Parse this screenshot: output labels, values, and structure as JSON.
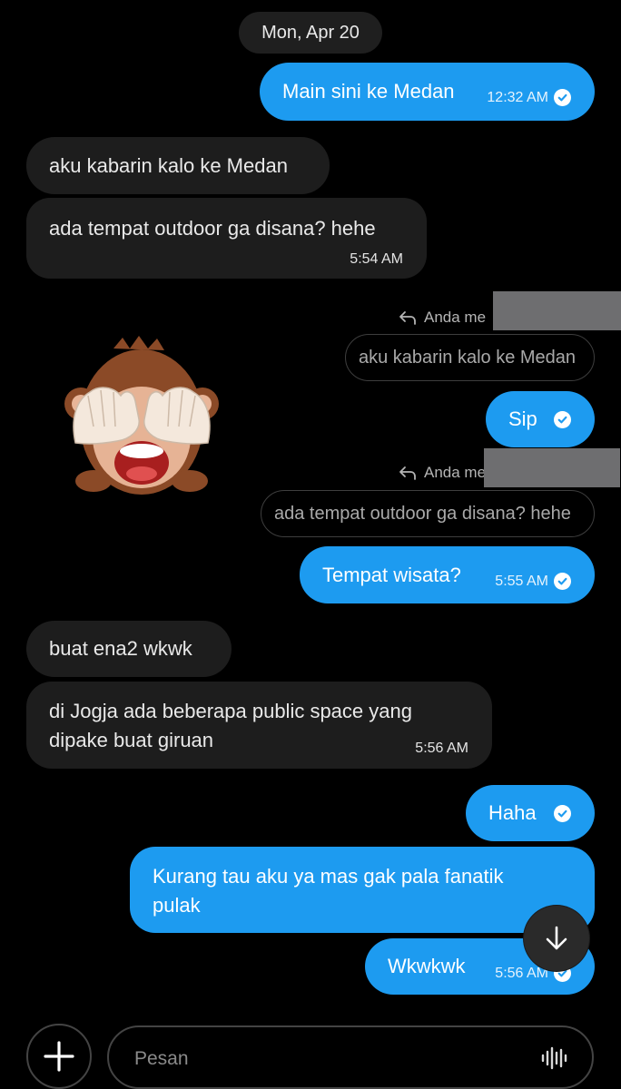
{
  "date_separator": "Mon, Apr 20",
  "messages": [
    {
      "text": "Main sini ke Medan",
      "time": "12:32 AM"
    },
    {
      "text": "aku kabarin kalo ke Medan"
    },
    {
      "text": "ada tempat outdoor ga disana? hehe",
      "time": "5:54 AM"
    },
    {
      "reply_label": "Anda me",
      "quoted": "aku kabarin kalo ke Medan",
      "text": "Sip"
    },
    {
      "reply_label": "Anda me",
      "quoted": "ada tempat outdoor ga disana? hehe",
      "text": "Tempat wisata?",
      "time": "5:55 AM"
    },
    {
      "text": "buat ena2 wkwk"
    },
    {
      "line1": "di Jogja ada beberapa public space yang",
      "line2": "dipake buat giruan",
      "time": "5:56 AM"
    },
    {
      "text": "Haha"
    },
    {
      "line1": "Kurang tau aku ya mas gak pala fanatik",
      "line2": "pulak"
    },
    {
      "text": "Wkwkwk",
      "time": "5:56 AM"
    }
  ],
  "sticker": {
    "icon": "see-no-evil-monkey-sticker"
  },
  "composer": {
    "placeholder": "Pesan",
    "add_icon": "plus-icon",
    "voice_icon": "voice-waveform-icon"
  },
  "scroll_button": {
    "icon": "arrow-down-icon"
  },
  "colors": {
    "outgoing": "#1d9bf0",
    "incoming": "#1d1d1d",
    "background": "#000000"
  }
}
